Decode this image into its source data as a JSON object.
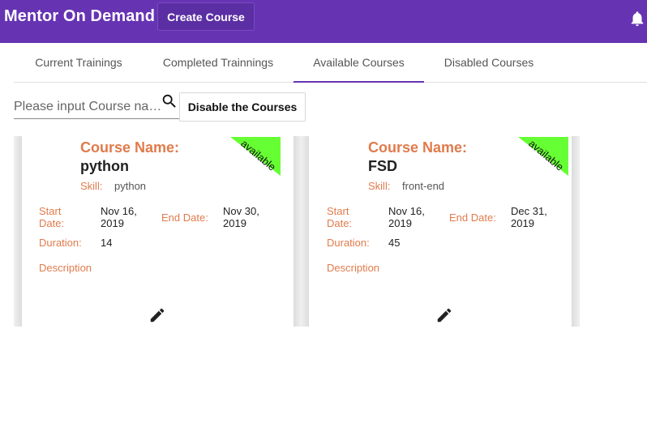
{
  "header": {
    "title": "Mentor On Demand",
    "create_course_label": "Create Course",
    "notification_icon": "bell-icon"
  },
  "tabs": [
    {
      "label": "Current Trainings",
      "active": false
    },
    {
      "label": "Completed Trainnings",
      "active": false
    },
    {
      "label": "Available Courses",
      "active": true
    },
    {
      "label": "Disabled Courses",
      "active": false
    }
  ],
  "search": {
    "placeholder": "Please input Course na…",
    "value": "",
    "icon": "search-icon"
  },
  "disable_button_label": "Disable the Courses",
  "labels": {
    "course_name": "Course Name:",
    "skill": "Skill:",
    "start_date_line1": "Start",
    "start_date_line2": "Date:",
    "end_date": "End Date:",
    "duration": "Duration:",
    "description": "Description"
  },
  "courses": [
    {
      "name": "python",
      "skill": "python",
      "start_date_line1": "Nov 16,",
      "start_date_line2": "2019",
      "end_date_line1": "Nov 30,",
      "end_date_line2": "2019",
      "duration": "14",
      "status": "available",
      "edit_icon": "pencil-icon"
    },
    {
      "name": "FSD",
      "skill": "front-end",
      "start_date_line1": "Nov 16,",
      "start_date_line2": "2019",
      "end_date_line1": "Dec 31,",
      "end_date_line2": "2019",
      "duration": "45",
      "status": "available",
      "edit_icon": "pencil-icon"
    }
  ],
  "colors": {
    "primary": "#6633b3",
    "label_orange": "#e07b4c",
    "status_green": "#66ff33"
  }
}
